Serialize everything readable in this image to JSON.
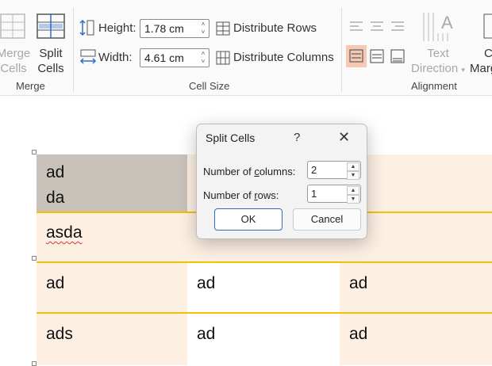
{
  "ribbon": {
    "merge": {
      "merge_cells_line1": "Merge",
      "merge_cells_line2": "Cells",
      "split_cells_line1": "Split",
      "split_cells_line2": "Cells",
      "group_label": "Merge"
    },
    "cell_size": {
      "height_label": "Height:",
      "height_value": "1.78 cm",
      "width_label": "Width:",
      "width_value": "4.61 cm",
      "distribute_rows": "Distribute Rows",
      "distribute_columns": "Distribute Columns",
      "group_label": "Cell Size"
    },
    "alignment": {
      "text_direction_line1": "Text",
      "text_direction_line2": "Direction",
      "cell_margins_line1": "C",
      "cell_margins_line2": "Marg",
      "group_label": "Alignment"
    }
  },
  "table": {
    "rows": [
      [
        "ad\nda",
        "",
        ""
      ],
      [
        "asda",
        "",
        ""
      ],
      [
        "ad",
        "ad",
        "ad"
      ],
      [
        "ads",
        "ad",
        "ad"
      ]
    ],
    "cell_r0c0_line1": "ad",
    "cell_r0c0_line2": "da",
    "cell_r1c0": "asda",
    "cell_r2c0": "ad",
    "cell_r2c1": "ad",
    "cell_r2c2": "ad",
    "cell_r3c0": "ads",
    "cell_r3c1": "ad",
    "cell_r3c2": "ad",
    "row_border_color": "#f2c200",
    "shade_color": "#fdf0e3",
    "selected_color": "#c9c2bb"
  },
  "dialog": {
    "title": "Split Cells",
    "help": "?",
    "close": "✕",
    "columns_label": "Number of columns:",
    "columns_value": "2",
    "rows_label": "Number of rows:",
    "rows_value": "1",
    "ok": "OK",
    "cancel": "Cancel"
  }
}
